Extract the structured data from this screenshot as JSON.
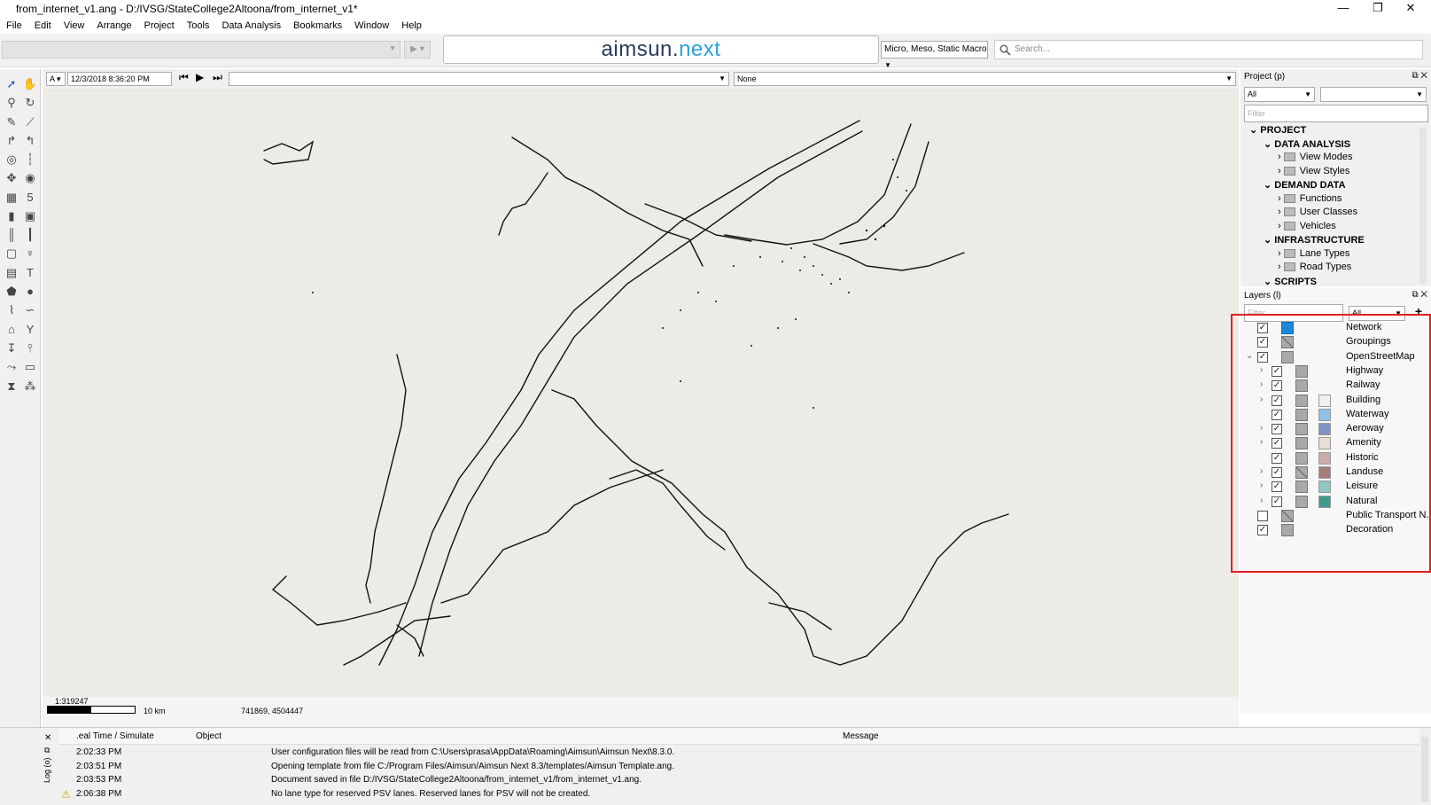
{
  "window": {
    "title": "from_internet_v1.ang - D:/IVSG/StateCollege2Altoona/from_internet_v1*",
    "controls": [
      "—",
      "❐",
      "✕"
    ]
  },
  "menu": [
    "File",
    "Edit",
    "View",
    "Arrange",
    "Project",
    "Tools",
    "Data Analysis",
    "Bookmarks",
    "Window",
    "Help"
  ],
  "toolbar": {
    "logo_main": "aimsun.",
    "logo_accent": "next",
    "mode_select": "Micro, Meso, Static Macro",
    "search_placeholder": "Search..."
  },
  "timebar": {
    "layer_letter": "A",
    "datetime": "12/3/2018 8:36:20 PM",
    "right_combo": "None"
  },
  "map": {
    "scale_ratio": "1:319247",
    "scale_distance": "10 km",
    "coordinates": "741869, 4504447"
  },
  "project_panel": {
    "title": "Project (p)",
    "combo_left": "All",
    "filter_placeholder": "Filter",
    "tree": [
      {
        "label": "PROJECT",
        "level": 0,
        "bold": true
      },
      {
        "label": "DATA ANALYSIS",
        "level": 1,
        "bold": true
      },
      {
        "label": "View Modes",
        "level": 2,
        "bold": false
      },
      {
        "label": "View Styles",
        "level": 2,
        "bold": false
      },
      {
        "label": "DEMAND DATA",
        "level": 1,
        "bold": true
      },
      {
        "label": "Functions",
        "level": 2,
        "bold": false
      },
      {
        "label": "User Classes",
        "level": 2,
        "bold": false
      },
      {
        "label": "Vehicles",
        "level": 2,
        "bold": false
      },
      {
        "label": "INFRASTRUCTURE",
        "level": 1,
        "bold": true
      },
      {
        "label": "Lane Types",
        "level": 2,
        "bold": false
      },
      {
        "label": "Road Types",
        "level": 2,
        "bold": false
      },
      {
        "label": "SCRIPTS",
        "level": 1,
        "bold": true
      }
    ]
  },
  "layers_panel": {
    "title": "Layers (l)",
    "filter_placeholder": "Filter",
    "combo": "All",
    "add": "+",
    "layers": [
      {
        "name": "Network",
        "checked": true,
        "indent": 0,
        "expander": "",
        "swatch": "",
        "icon": "network"
      },
      {
        "name": "Groupings",
        "checked": true,
        "indent": 0,
        "expander": "",
        "swatch": "",
        "icon": "crossed"
      },
      {
        "name": "OpenStreetMap",
        "checked": true,
        "indent": 0,
        "expander": "⌄",
        "swatch": "",
        "icon": "plain"
      },
      {
        "name": "Highway",
        "checked": true,
        "indent": 1,
        "expander": "›",
        "swatch": "",
        "icon": "plain"
      },
      {
        "name": "Railway",
        "checked": true,
        "indent": 1,
        "expander": "›",
        "swatch": "",
        "icon": "plain"
      },
      {
        "name": "Building",
        "checked": true,
        "indent": 1,
        "expander": "›",
        "swatch": "#f2f0ea",
        "icon": "plain"
      },
      {
        "name": "Waterway",
        "checked": true,
        "indent": 1,
        "expander": "",
        "swatch": "#8ec2e6",
        "icon": "plain"
      },
      {
        "name": "Aeroway",
        "checked": true,
        "indent": 1,
        "expander": "›",
        "swatch": "#7e93c2",
        "icon": "plain"
      },
      {
        "name": "Amenity",
        "checked": true,
        "indent": 1,
        "expander": "›",
        "swatch": "#e9ded4",
        "icon": "plain"
      },
      {
        "name": "Historic",
        "checked": true,
        "indent": 1,
        "expander": "",
        "swatch": "#c9aca8",
        "icon": "plain"
      },
      {
        "name": "Landuse",
        "checked": true,
        "indent": 1,
        "expander": "›",
        "swatch": "#a67c7a",
        "icon": "crossed"
      },
      {
        "name": "Leisure",
        "checked": true,
        "indent": 1,
        "expander": "›",
        "swatch": "#8fc9c2",
        "icon": "plain"
      },
      {
        "name": "Natural",
        "checked": true,
        "indent": 1,
        "expander": "›",
        "swatch": "#3f9a8c",
        "icon": "plain"
      },
      {
        "name": "Public Transport N...",
        "checked": false,
        "indent": 0,
        "expander": "",
        "swatch": "",
        "icon": "crossed"
      },
      {
        "name": "Decoration",
        "checked": true,
        "indent": 0,
        "expander": "",
        "swatch": "",
        "icon": "plain"
      }
    ]
  },
  "log": {
    "side_label": "Log (o)",
    "columns": [
      ".eal Time / Simulate",
      "Object",
      "Message"
    ],
    "rows": [
      {
        "time": "2:02:33 PM",
        "warn": false,
        "message": "User configuration files will be read from C:\\Users\\prasa\\AppData\\Roaming\\Aimsun\\Aimsun Next\\8.3.0."
      },
      {
        "time": "2:03:51 PM",
        "warn": false,
        "message": "Opening template from file C:/Program Files/Aimsun/Aimsun Next 8.3/templates/Aimsun Template.ang."
      },
      {
        "time": "2:03:53 PM",
        "warn": false,
        "message": "Document saved in file D:/IVSG/StateCollege2Altoona/from_internet_v1/from_internet_v1.ang."
      },
      {
        "time": "2:06:38 PM",
        "warn": true,
        "message": "No lane type for reserved PSV lanes. Reserved lanes for PSV will not be created."
      }
    ]
  }
}
